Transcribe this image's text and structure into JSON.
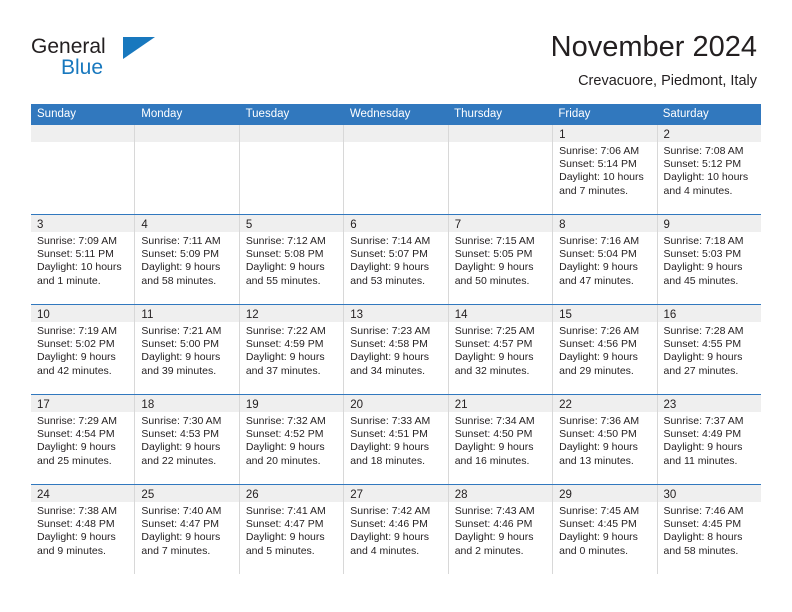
{
  "brand": {
    "name_part1": "General",
    "name_part2": "Blue",
    "accent_color": "#1878be"
  },
  "header": {
    "title": "November 2024",
    "subtitle": "Crevacuore, Piedmont, Italy"
  },
  "calendar": {
    "header_bg": "#3178be",
    "daynum_bg": "#efefef",
    "weekdays": [
      "Sunday",
      "Monday",
      "Tuesday",
      "Wednesday",
      "Thursday",
      "Friday",
      "Saturday"
    ],
    "weeks": [
      [
        {
          "empty": true
        },
        {
          "empty": true
        },
        {
          "empty": true
        },
        {
          "empty": true
        },
        {
          "empty": true
        },
        {
          "day": "1",
          "sunrise": "Sunrise: 7:06 AM",
          "sunset": "Sunset: 5:14 PM",
          "daylight": "Daylight: 10 hours and 7 minutes."
        },
        {
          "day": "2",
          "sunrise": "Sunrise: 7:08 AM",
          "sunset": "Sunset: 5:12 PM",
          "daylight": "Daylight: 10 hours and 4 minutes."
        }
      ],
      [
        {
          "day": "3",
          "sunrise": "Sunrise: 7:09 AM",
          "sunset": "Sunset: 5:11 PM",
          "daylight": "Daylight: 10 hours and 1 minute."
        },
        {
          "day": "4",
          "sunrise": "Sunrise: 7:11 AM",
          "sunset": "Sunset: 5:09 PM",
          "daylight": "Daylight: 9 hours and 58 minutes."
        },
        {
          "day": "5",
          "sunrise": "Sunrise: 7:12 AM",
          "sunset": "Sunset: 5:08 PM",
          "daylight": "Daylight: 9 hours and 55 minutes."
        },
        {
          "day": "6",
          "sunrise": "Sunrise: 7:14 AM",
          "sunset": "Sunset: 5:07 PM",
          "daylight": "Daylight: 9 hours and 53 minutes."
        },
        {
          "day": "7",
          "sunrise": "Sunrise: 7:15 AM",
          "sunset": "Sunset: 5:05 PM",
          "daylight": "Daylight: 9 hours and 50 minutes."
        },
        {
          "day": "8",
          "sunrise": "Sunrise: 7:16 AM",
          "sunset": "Sunset: 5:04 PM",
          "daylight": "Daylight: 9 hours and 47 minutes."
        },
        {
          "day": "9",
          "sunrise": "Sunrise: 7:18 AM",
          "sunset": "Sunset: 5:03 PM",
          "daylight": "Daylight: 9 hours and 45 minutes."
        }
      ],
      [
        {
          "day": "10",
          "sunrise": "Sunrise: 7:19 AM",
          "sunset": "Sunset: 5:02 PM",
          "daylight": "Daylight: 9 hours and 42 minutes."
        },
        {
          "day": "11",
          "sunrise": "Sunrise: 7:21 AM",
          "sunset": "Sunset: 5:00 PM",
          "daylight": "Daylight: 9 hours and 39 minutes."
        },
        {
          "day": "12",
          "sunrise": "Sunrise: 7:22 AM",
          "sunset": "Sunset: 4:59 PM",
          "daylight": "Daylight: 9 hours and 37 minutes."
        },
        {
          "day": "13",
          "sunrise": "Sunrise: 7:23 AM",
          "sunset": "Sunset: 4:58 PM",
          "daylight": "Daylight: 9 hours and 34 minutes."
        },
        {
          "day": "14",
          "sunrise": "Sunrise: 7:25 AM",
          "sunset": "Sunset: 4:57 PM",
          "daylight": "Daylight: 9 hours and 32 minutes."
        },
        {
          "day": "15",
          "sunrise": "Sunrise: 7:26 AM",
          "sunset": "Sunset: 4:56 PM",
          "daylight": "Daylight: 9 hours and 29 minutes."
        },
        {
          "day": "16",
          "sunrise": "Sunrise: 7:28 AM",
          "sunset": "Sunset: 4:55 PM",
          "daylight": "Daylight: 9 hours and 27 minutes."
        }
      ],
      [
        {
          "day": "17",
          "sunrise": "Sunrise: 7:29 AM",
          "sunset": "Sunset: 4:54 PM",
          "daylight": "Daylight: 9 hours and 25 minutes."
        },
        {
          "day": "18",
          "sunrise": "Sunrise: 7:30 AM",
          "sunset": "Sunset: 4:53 PM",
          "daylight": "Daylight: 9 hours and 22 minutes."
        },
        {
          "day": "19",
          "sunrise": "Sunrise: 7:32 AM",
          "sunset": "Sunset: 4:52 PM",
          "daylight": "Daylight: 9 hours and 20 minutes."
        },
        {
          "day": "20",
          "sunrise": "Sunrise: 7:33 AM",
          "sunset": "Sunset: 4:51 PM",
          "daylight": "Daylight: 9 hours and 18 minutes."
        },
        {
          "day": "21",
          "sunrise": "Sunrise: 7:34 AM",
          "sunset": "Sunset: 4:50 PM",
          "daylight": "Daylight: 9 hours and 16 minutes."
        },
        {
          "day": "22",
          "sunrise": "Sunrise: 7:36 AM",
          "sunset": "Sunset: 4:50 PM",
          "daylight": "Daylight: 9 hours and 13 minutes."
        },
        {
          "day": "23",
          "sunrise": "Sunrise: 7:37 AM",
          "sunset": "Sunset: 4:49 PM",
          "daylight": "Daylight: 9 hours and 11 minutes."
        }
      ],
      [
        {
          "day": "24",
          "sunrise": "Sunrise: 7:38 AM",
          "sunset": "Sunset: 4:48 PM",
          "daylight": "Daylight: 9 hours and 9 minutes."
        },
        {
          "day": "25",
          "sunrise": "Sunrise: 7:40 AM",
          "sunset": "Sunset: 4:47 PM",
          "daylight": "Daylight: 9 hours and 7 minutes."
        },
        {
          "day": "26",
          "sunrise": "Sunrise: 7:41 AM",
          "sunset": "Sunset: 4:47 PM",
          "daylight": "Daylight: 9 hours and 5 minutes."
        },
        {
          "day": "27",
          "sunrise": "Sunrise: 7:42 AM",
          "sunset": "Sunset: 4:46 PM",
          "daylight": "Daylight: 9 hours and 4 minutes."
        },
        {
          "day": "28",
          "sunrise": "Sunrise: 7:43 AM",
          "sunset": "Sunset: 4:46 PM",
          "daylight": "Daylight: 9 hours and 2 minutes."
        },
        {
          "day": "29",
          "sunrise": "Sunrise: 7:45 AM",
          "sunset": "Sunset: 4:45 PM",
          "daylight": "Daylight: 9 hours and 0 minutes."
        },
        {
          "day": "30",
          "sunrise": "Sunrise: 7:46 AM",
          "sunset": "Sunset: 4:45 PM",
          "daylight": "Daylight: 8 hours and 58 minutes."
        }
      ]
    ]
  }
}
